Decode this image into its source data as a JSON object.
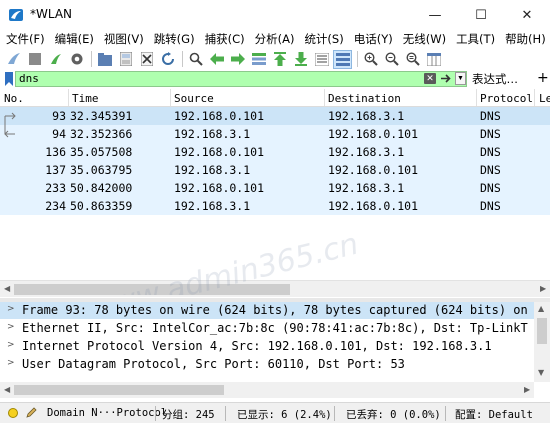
{
  "window": {
    "title": "*WLAN",
    "minimize": "—",
    "maximize": "☐",
    "close": "✕"
  },
  "menu": [
    "文件(F)",
    "编辑(E)",
    "视图(V)",
    "跳转(G)",
    "捕获(C)",
    "分析(A)",
    "统计(S)",
    "电话(Y)",
    "无线(W)",
    "工具(T)",
    "帮助(H)"
  ],
  "filter": {
    "value": "dns",
    "expression_label": "表达式…",
    "add_label": "+",
    "clear_glyph": "✕",
    "dropdown_glyph": "▼",
    "accent": "#afffaf"
  },
  "packet_list": {
    "columns": [
      "No.",
      "Time",
      "Source",
      "Destination",
      "Protocol",
      "Le"
    ],
    "rows": [
      {
        "no": "93",
        "time": "32.345391",
        "source": "192.168.0.101",
        "destination": "192.168.3.1",
        "protocol": "DNS"
      },
      {
        "no": "94",
        "time": "32.352366",
        "source": "192.168.3.1",
        "destination": "192.168.0.101",
        "protocol": "DNS"
      },
      {
        "no": "136",
        "time": "35.057508",
        "source": "192.168.0.101",
        "destination": "192.168.3.1",
        "protocol": "DNS"
      },
      {
        "no": "137",
        "time": "35.063795",
        "source": "192.168.3.1",
        "destination": "192.168.0.101",
        "protocol": "DNS"
      },
      {
        "no": "233",
        "time": "50.842000",
        "source": "192.168.0.101",
        "destination": "192.168.3.1",
        "protocol": "DNS"
      },
      {
        "no": "234",
        "time": "50.863359",
        "source": "192.168.3.1",
        "destination": "192.168.0.101",
        "protocol": "DNS"
      }
    ],
    "row_color": "#e5f3ff",
    "selected_color": "#cce4f7"
  },
  "details": [
    "Frame 93: 78 bytes on wire (624 bits), 78 bytes captured (624 bits) on",
    "Ethernet II, Src: IntelCor_ac:7b:8c (90:78:41:ac:7b:8c), Dst: Tp-LinkT",
    "Internet Protocol Version 4, Src: 192.168.0.101, Dst: 192.168.3.1",
    "User Datagram Protocol, Src Port: 60110, Dst Port: 53"
  ],
  "status": {
    "profile_field": "Domain N···Protocol",
    "packets": "分组: 245",
    "displayed": "已显示: 6 (2.4%)",
    "dropped": "已丢弃: 0 (0.0%)",
    "config": "配置: Default"
  },
  "watermark": "www.admin365.cn"
}
